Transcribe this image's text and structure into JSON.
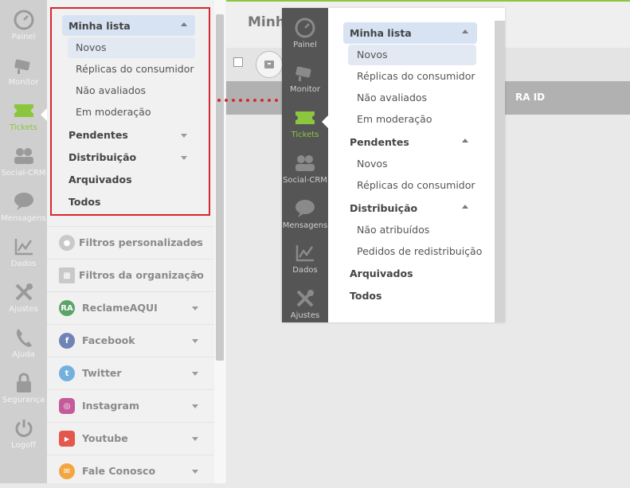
{
  "rail": {
    "items": [
      {
        "label": "Painel",
        "icon": "gauge-icon"
      },
      {
        "label": "Monitor",
        "icon": "camera-icon"
      },
      {
        "label": "Tickets",
        "icon": "ticket-icon",
        "active": true
      },
      {
        "label": "Social-CRM",
        "icon": "users-icon"
      },
      {
        "label": "Mensagens",
        "icon": "chat-bubble-icon"
      },
      {
        "label": "Dados",
        "icon": "chart-line-icon"
      },
      {
        "label": "Ajustes",
        "icon": "tools-icon"
      },
      {
        "label": "Ajuda",
        "icon": "phone-icon"
      },
      {
        "label": "Segurança",
        "icon": "lock-icon"
      },
      {
        "label": "Logoff",
        "icon": "power-icon"
      }
    ]
  },
  "sidebar": {
    "minha_lista": "Minha lista",
    "minha_sub": [
      "Novos",
      "Réplicas do consumidor",
      "Não avaliados",
      "Em moderação"
    ],
    "pendentes": "Pendentes",
    "distribuicao": "Distribuição",
    "arquivados": "Arquivados",
    "todos": "Todos",
    "filtros_personalizados": "Filtros personalizados",
    "filtros_organizacao": "Filtros da organização",
    "channels": [
      {
        "label": "ReclameAQUI",
        "badge": "RA",
        "color": "#5aa46a"
      },
      {
        "label": "Facebook",
        "badge": "f",
        "color": "#6f83b7"
      },
      {
        "label": "Twitter",
        "badge": "t",
        "color": "#74b0de"
      },
      {
        "label": "Instagram",
        "badge": "◎",
        "color": "#c55a9b"
      },
      {
        "label": "Youtube",
        "badge": "▶",
        "color": "#e4574d"
      },
      {
        "label": "Fale Conosco",
        "badge": "✉",
        "color": "#f2a641"
      }
    ]
  },
  "main": {
    "title": "Minha",
    "col_ra_id": "RA ID"
  },
  "popup": {
    "minha_lista": "Minha lista",
    "minha_sub": [
      "Novos",
      "Réplicas do consumidor",
      "Não avaliados",
      "Em moderação"
    ],
    "pendentes": "Pendentes",
    "pendentes_sub": [
      "Novos",
      "Réplicas do consumidor"
    ],
    "distribuicao": "Distribuição",
    "distribuicao_sub": [
      "Não atribuídos",
      "Pedidos de redistribuição"
    ],
    "arquivados": "Arquivados",
    "todos": "Todos",
    "rail": [
      {
        "label": "Painel",
        "icon": "gauge-icon"
      },
      {
        "label": "Monitor",
        "icon": "camera-icon"
      },
      {
        "label": "Tickets",
        "icon": "ticket-icon",
        "active": true
      },
      {
        "label": "Social-CRM",
        "icon": "users-icon"
      },
      {
        "label": "Mensagens",
        "icon": "chat-bubble-icon"
      },
      {
        "label": "Dados",
        "icon": "chart-line-icon"
      },
      {
        "label": "Ajustes",
        "icon": "tools-icon"
      }
    ]
  },
  "colors": {
    "accent_green": "#8cc63f",
    "highlight_red": "#d62830",
    "selected_blue": "#d7e3f3"
  }
}
